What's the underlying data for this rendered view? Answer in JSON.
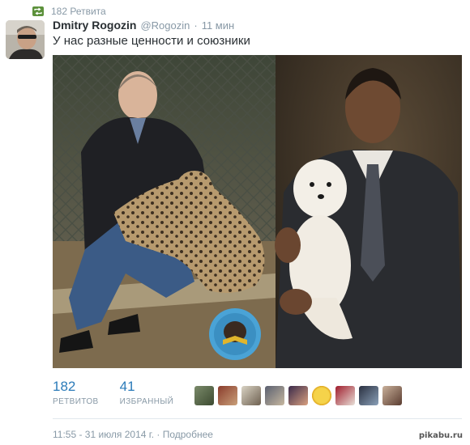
{
  "retweet": {
    "icon": "retweet-icon",
    "label": "182 Ретвита",
    "color": "#5c913b"
  },
  "tweet": {
    "fullname": "Dmitry Rogozin",
    "username": "@Rogozin",
    "separator": "·",
    "time": "11 мин",
    "text": "У нас разные ценности и союзники"
  },
  "stats": {
    "retweets": {
      "count": "182",
      "label": "РЕТВИТОВ"
    },
    "favorites": {
      "count": "41",
      "label": "ИЗБРАННЫЙ"
    }
  },
  "favoriters": [
    "user-avatar-1",
    "user-avatar-2",
    "user-avatar-3",
    "user-avatar-4",
    "user-avatar-5",
    "user-avatar-6",
    "user-avatar-7",
    "user-avatar-8",
    "user-avatar-9"
  ],
  "footer": {
    "timestamp": "11:55 - 31 июля 2014 г.",
    "separator": " · ",
    "details": "Подробнее"
  },
  "watermark": "pikabu.ru",
  "colors": {
    "link": "#2b7bb9",
    "muted": "#8899a6",
    "text": "#292f33"
  }
}
